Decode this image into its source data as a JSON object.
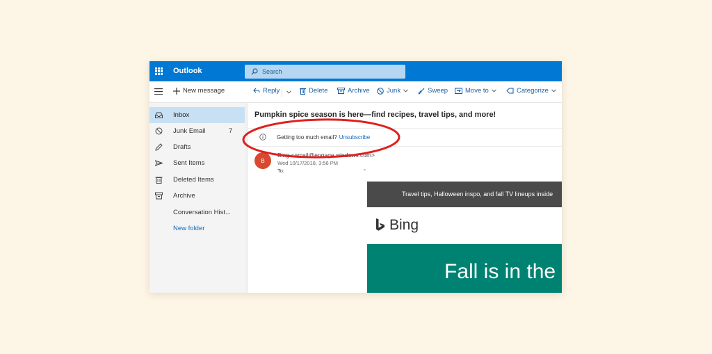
{
  "app": {
    "title": "Outlook"
  },
  "search": {
    "placeholder": "Search"
  },
  "toolbar": {
    "new_message": "New message",
    "reply": "Reply",
    "delete": "Delete",
    "archive": "Archive",
    "junk": "Junk",
    "sweep": "Sweep",
    "move_to": "Move to",
    "categorize": "Categorize"
  },
  "sidebar": {
    "items": [
      {
        "label": "Inbox",
        "icon": "inbox-icon"
      },
      {
        "label": "Junk Email",
        "icon": "junk-icon",
        "count": "7"
      },
      {
        "label": "Drafts",
        "icon": "pencil-icon"
      },
      {
        "label": "Sent Items",
        "icon": "send-icon"
      },
      {
        "label": "Deleted Items",
        "icon": "trash-icon"
      },
      {
        "label": "Archive",
        "icon": "archive-icon"
      },
      {
        "label": "Conversation Hist..."
      },
      {
        "label": "New folder"
      }
    ]
  },
  "message": {
    "subject": "Pumpkin spice season is here—find recipes, travel tips, and more!",
    "info_text": "Getting too much email?",
    "unsubscribe": "Unsubscribe",
    "avatar_initial": "B",
    "sender": "Bing <email@engage.windows.com>",
    "date": "Wed 10/17/2018, 3:56 PM",
    "to_label": "To:",
    "body": {
      "banner": "Travel tips, Halloween inspo, and fall TV lineups inside",
      "logo_text": "Bing",
      "hero": "Fall is in the air"
    }
  },
  "colors": {
    "header": "#0078d4",
    "selected": "#c7e0f4",
    "annotation": "#e0201d",
    "hero": "#008272"
  }
}
